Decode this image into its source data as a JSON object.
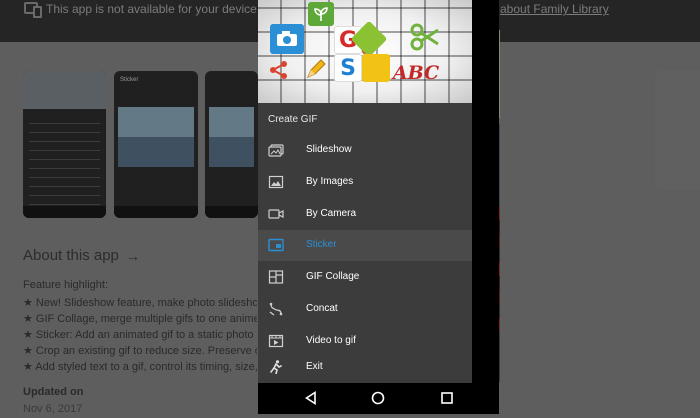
{
  "store": {
    "notice": "This app is not available for your device",
    "family_link": "about Family Library",
    "about_title": "About this app",
    "feature_lines": [
      "Feature highlight:",
      "★ New! Slideshow feature, make photo slideshow a",
      "★ GIF Collage, merge multiple gifs to one anime",
      "★ Sticker: Add an animated gif to a static photo or",
      "★ Crop an existing gif to reduce size. Preserve origi",
      "★ Add styled text to a gif, control its timing, size, st"
    ],
    "updated_label": "Updated on",
    "updated_value": "Nov 6, 2017",
    "screenshot_header": "Sticker"
  },
  "app_menu": {
    "title": "Create GIF",
    "items": [
      {
        "label": "Slideshow",
        "icon": "slideshow-icon",
        "active": false
      },
      {
        "label": "By Images",
        "icon": "image-icon",
        "active": false
      },
      {
        "label": "By Camera",
        "icon": "video-camera-icon",
        "active": false
      },
      {
        "label": "Sticker",
        "icon": "sticker-icon",
        "active": true
      },
      {
        "label": "GIF Collage",
        "icon": "collage-icon",
        "active": false
      },
      {
        "label": "Concat",
        "icon": "concat-icon",
        "active": false
      },
      {
        "label": "Video to gif",
        "icon": "video-film-icon",
        "active": false
      },
      {
        "label": "Exit",
        "icon": "exit-running-icon",
        "active": false
      }
    ]
  },
  "banner_tiles": {
    "g_letter": "G",
    "s_letter": "S",
    "abc_text": "ABC"
  },
  "colors": {
    "accent": "#2a8fd4",
    "menu_bg": "#3c3c3c",
    "active_bg": "#4a4a4a"
  },
  "system_nav": [
    "back-icon",
    "home-icon",
    "recents-icon"
  ]
}
